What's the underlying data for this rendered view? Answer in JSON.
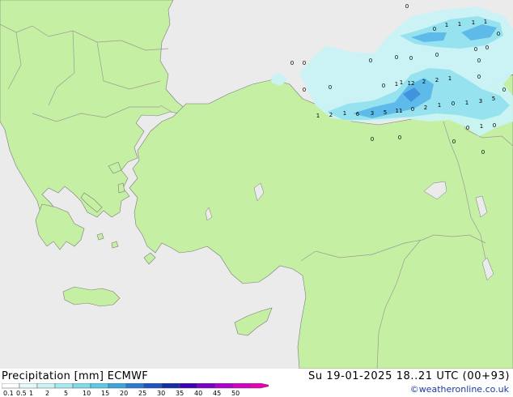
{
  "map": {
    "colors": {
      "sea": "#ebebeb",
      "land": "#c5f0a3",
      "border": "#9a9a9a",
      "coast": "#7a7a7a",
      "precip_light": "#c9f3f6",
      "precip_mid": "#93e0ee",
      "precip_dark": "#5bb8e8",
      "precip_max": "#3d8fdc"
    },
    "values": [
      {
        "t": "0"
      },
      {
        "t": "0"
      },
      {
        "t": "1"
      },
      {
        "t": "1"
      },
      {
        "t": "1"
      },
      {
        "t": "1"
      },
      {
        "t": "0"
      },
      {
        "t": "0"
      },
      {
        "t": "0"
      },
      {
        "t": "0"
      },
      {
        "t": "0"
      },
      {
        "t": "0"
      },
      {
        "t": "0"
      },
      {
        "t": "0"
      },
      {
        "t": "0"
      },
      {
        "t": "0"
      },
      {
        "t": "0"
      },
      {
        "t": "1"
      },
      {
        "t": "0"
      },
      {
        "t": "1"
      },
      {
        "t": "12"
      },
      {
        "t": "2"
      },
      {
        "t": "2"
      },
      {
        "t": "1"
      },
      {
        "t": "0"
      },
      {
        "t": "0"
      },
      {
        "t": "1"
      },
      {
        "t": "2"
      },
      {
        "t": "6"
      },
      {
        "t": "3"
      },
      {
        "t": "5"
      },
      {
        "t": "11"
      },
      {
        "t": "0"
      },
      {
        "t": "2"
      },
      {
        "t": "1"
      },
      {
        "t": "0"
      },
      {
        "t": "1"
      },
      {
        "t": "3"
      },
      {
        "t": "5"
      },
      {
        "t": "1"
      },
      {
        "t": "0"
      },
      {
        "t": "1"
      },
      {
        "t": "0"
      },
      {
        "t": "0"
      },
      {
        "t": "0"
      },
      {
        "t": "0"
      },
      {
        "t": "0"
      },
      {
        "t": "0"
      }
    ]
  },
  "footer": {
    "title": "Precipitation [mm]  ECMWF",
    "run": "Su 19-01-2025 18..21 UTC (00+93)",
    "credit": "©weatheronline.co.uk",
    "scale": {
      "labels": [
        "0.1",
        "0.5",
        "1",
        "2",
        "5",
        "10",
        "15",
        "20",
        "25",
        "30",
        "35",
        "40",
        "45",
        "50"
      ],
      "colors": [
        "#ffffff",
        "#e5fbfb",
        "#c9f3f6",
        "#a7e9f1",
        "#7fdceb",
        "#5bcae6",
        "#3aa6dd",
        "#2b7bd3",
        "#1f52c7",
        "#142ea8",
        "#3d00b5",
        "#7c00c8",
        "#b000d0",
        "#d400c8",
        "#e800b6"
      ]
    }
  }
}
